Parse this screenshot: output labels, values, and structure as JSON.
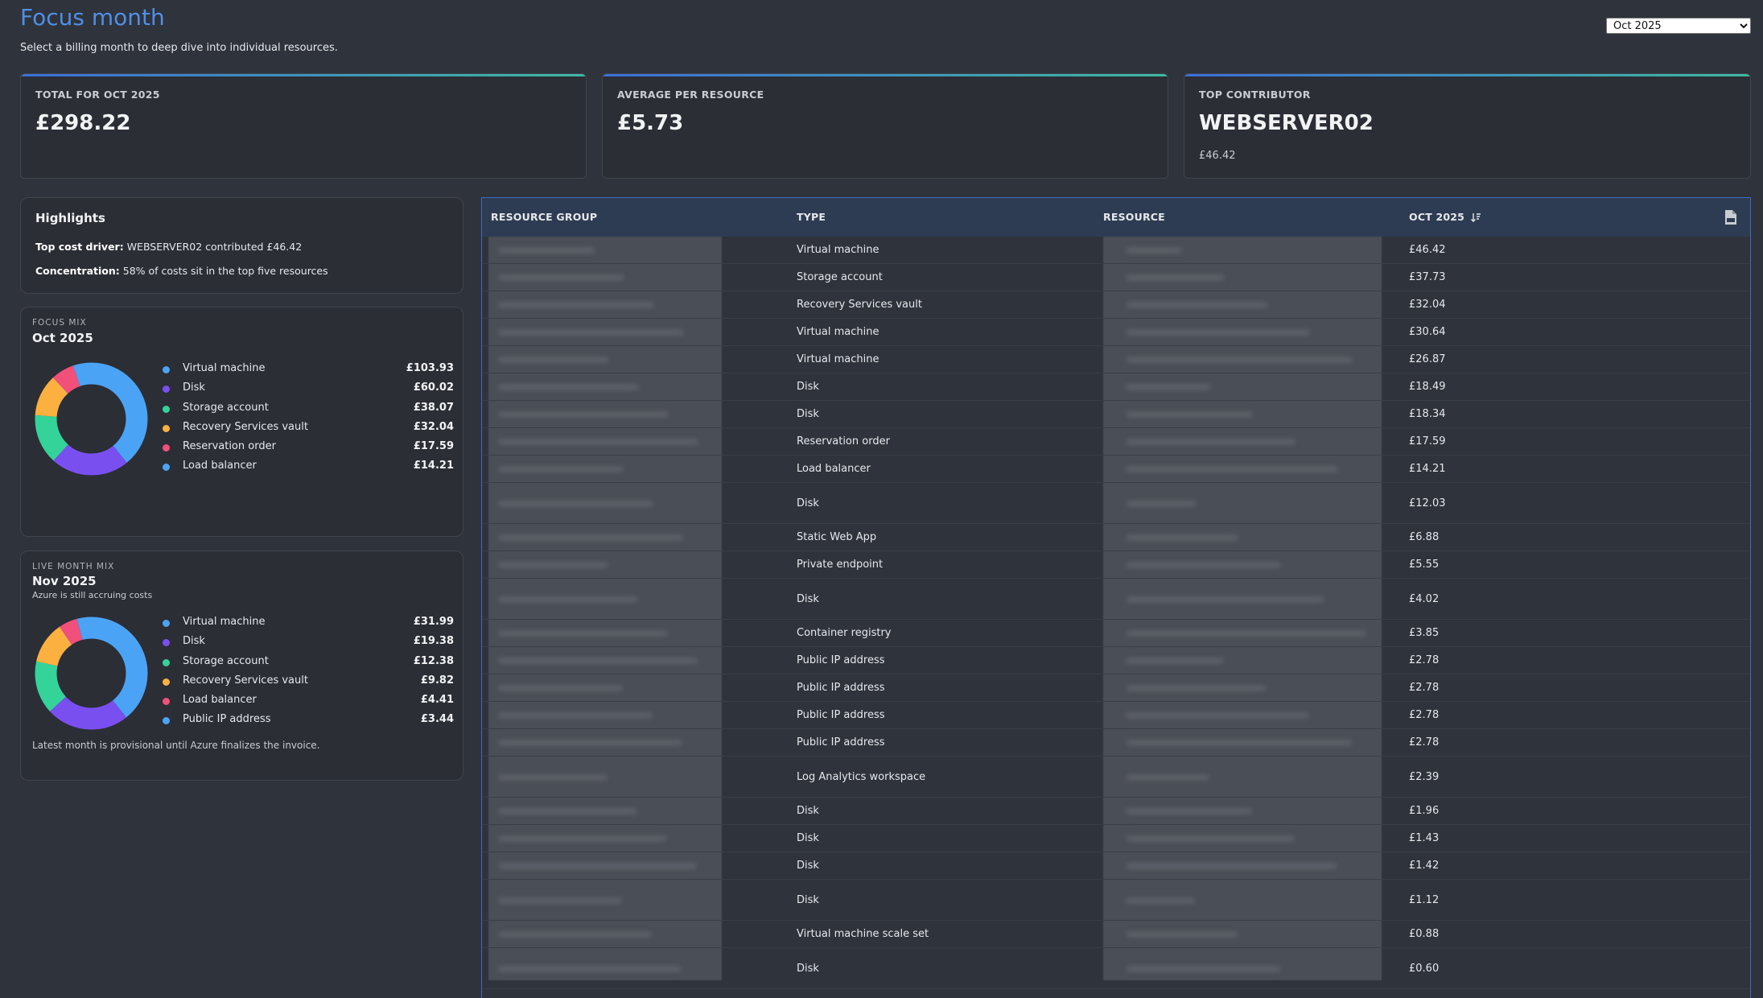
{
  "header": {
    "title": "Focus month",
    "subtitle": "Select a billing month to deep dive into individual resources.",
    "month_select": {
      "selected": "Oct 2025",
      "options": [
        "Oct 2025"
      ]
    }
  },
  "kpis": [
    {
      "label": "TOTAL FOR OCT 2025",
      "value": "£298.22",
      "sub": ""
    },
    {
      "label": "AVERAGE PER RESOURCE",
      "value": "£5.73",
      "sub": ""
    },
    {
      "label": "TOP CONTRIBUTOR",
      "value": "WEBSERVER02",
      "sub": "£46.42"
    }
  ],
  "highlights": {
    "title": "Highlights",
    "lines": [
      {
        "label": "Top cost driver:",
        "text": " WEBSERVER02 contributed £46.42"
      },
      {
        "label": "Concentration:",
        "text": " 58% of costs sit in the top five resources"
      }
    ]
  },
  "colors": {
    "Virtual machine": "#4ba3f5",
    "Disk": "#7a4ff0",
    "Storage account": "#34d399",
    "Recovery Services vault": "#fbb040",
    "Reservation order": "#f0507a",
    "Load balancer": "#4ba3f5",
    "Public IP address": "#4ba3f5"
  },
  "focus_mix": {
    "eyebrow": "FOCUS MIX",
    "month": "Oct 2025",
    "note": "",
    "items": [
      {
        "label": "Virtual machine",
        "value": "£103.93",
        "amount": 103.93,
        "color": "#4ba3f5"
      },
      {
        "label": "Disk",
        "value": "£60.02",
        "amount": 60.02,
        "color": "#7a4ff0"
      },
      {
        "label": "Storage account",
        "value": "£38.07",
        "amount": 38.07,
        "color": "#34d399"
      },
      {
        "label": "Recovery Services vault",
        "value": "£32.04",
        "amount": 32.04,
        "color": "#fbb040"
      },
      {
        "label": "Reservation order",
        "value": "£17.59",
        "amount": 17.59,
        "color": "#f0507a"
      },
      {
        "label": "Load balancer",
        "value": "£14.21",
        "amount": 14.21,
        "color": "#4ba3f5"
      }
    ],
    "footer": ""
  },
  "live_mix": {
    "eyebrow": "LIVE MONTH MIX",
    "month": "Nov 2025",
    "note": "Azure is still accruing costs",
    "items": [
      {
        "label": "Virtual machine",
        "value": "£31.99",
        "amount": 31.99,
        "color": "#4ba3f5"
      },
      {
        "label": "Disk",
        "value": "£19.38",
        "amount": 19.38,
        "color": "#7a4ff0"
      },
      {
        "label": "Storage account",
        "value": "£12.38",
        "amount": 12.38,
        "color": "#34d399"
      },
      {
        "label": "Recovery Services vault",
        "value": "£9.82",
        "amount": 9.82,
        "color": "#fbb040"
      },
      {
        "label": "Load balancer",
        "value": "£4.41",
        "amount": 4.41,
        "color": "#f0507a"
      },
      {
        "label": "Public IP address",
        "value": "£3.44",
        "amount": 3.44,
        "color": "#4ba3f5"
      }
    ],
    "footer": "Latest month is provisional until Azure finalizes the invoice."
  },
  "table": {
    "columns": [
      "RESOURCE GROUP",
      "TYPE",
      "RESOURCE",
      "OCT 2025"
    ],
    "sort_icon": "sort-descending-icon",
    "export_icon": "csv-file-icon",
    "rows": [
      {
        "type": "Virtual machine",
        "cost": "£46.42"
      },
      {
        "type": "Storage account",
        "cost": "£37.73"
      },
      {
        "type": "Recovery Services vault",
        "cost": "£32.04"
      },
      {
        "type": "Virtual machine",
        "cost": "£30.64"
      },
      {
        "type": "Virtual machine",
        "cost": "£26.87"
      },
      {
        "type": "Disk",
        "cost": "£18.49"
      },
      {
        "type": "Disk",
        "cost": "£18.34"
      },
      {
        "type": "Reservation order",
        "cost": "£17.59"
      },
      {
        "type": "Load balancer",
        "cost": "£14.21"
      },
      {
        "type": "Disk",
        "cost": "£12.03"
      },
      {
        "type": "Static Web App",
        "cost": "£6.88"
      },
      {
        "type": "Private endpoint",
        "cost": "£5.55"
      },
      {
        "type": "Disk",
        "cost": "£4.02"
      },
      {
        "type": "Container registry",
        "cost": "£3.85"
      },
      {
        "type": "Public IP address",
        "cost": "£2.78"
      },
      {
        "type": "Public IP address",
        "cost": "£2.78"
      },
      {
        "type": "Public IP address",
        "cost": "£2.78"
      },
      {
        "type": "Public IP address",
        "cost": "£2.78"
      },
      {
        "type": "Log Analytics workspace",
        "cost": "£2.39"
      },
      {
        "type": "Disk",
        "cost": "£1.96"
      },
      {
        "type": "Disk",
        "cost": "£1.43"
      },
      {
        "type": "Disk",
        "cost": "£1.42"
      },
      {
        "type": "Disk",
        "cost": "£1.12"
      },
      {
        "type": "Virtual machine scale set",
        "cost": "£0.88"
      },
      {
        "type": "Disk",
        "cost": "£0.60"
      }
    ]
  }
}
